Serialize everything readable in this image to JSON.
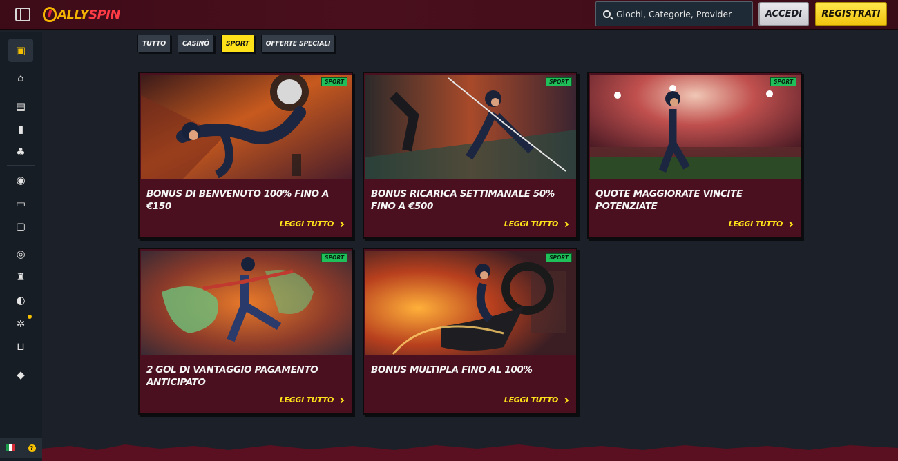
{
  "header": {
    "logo_part1": "ALLY",
    "logo_part2": "SPIN",
    "search_placeholder": "Giochi, Categorie, Provider",
    "login_label": "ACCEDI",
    "register_label": "REGISTRATI"
  },
  "sidebar": {
    "items": [
      {
        "icon": "gift-icon",
        "glyph": "▣"
      },
      {
        "icon": "home-icon",
        "glyph": "⌂"
      },
      {
        "icon": "slot-machine-icon",
        "glyph": "▤"
      },
      {
        "icon": "cards-icon",
        "glyph": "▮"
      },
      {
        "icon": "clover-icon",
        "glyph": "♣"
      },
      {
        "icon": "football-icon",
        "glyph": "◉"
      },
      {
        "icon": "live-icon",
        "glyph": "▭"
      },
      {
        "icon": "live-casino-icon",
        "glyph": "▢"
      },
      {
        "icon": "medal-icon",
        "glyph": "◎"
      },
      {
        "icon": "trophy-icon",
        "glyph": "♜"
      },
      {
        "icon": "helmet-icon",
        "glyph": "◐"
      },
      {
        "icon": "film-reel-icon",
        "glyph": "✲"
      },
      {
        "icon": "cart-icon",
        "glyph": "⊔"
      },
      {
        "icon": "diamond-icon",
        "glyph": "◆"
      }
    ],
    "help_glyph": "?"
  },
  "tabs": [
    {
      "label": "TUTTO",
      "active": false
    },
    {
      "label": "CASINÒ",
      "active": false
    },
    {
      "label": "SPORT",
      "active": true
    },
    {
      "label": "OFFERTE SPECIALI",
      "active": false
    }
  ],
  "cards": [
    {
      "badge": "SPORT",
      "title": "BONUS DI BENVENUTO 100% FINO A €150",
      "link": "LEGGI TUTTO"
    },
    {
      "badge": "SPORT",
      "title": "BONUS RICARICA SETTIMANALE 50% FINO A €500",
      "link": "LEGGI TUTTO"
    },
    {
      "badge": "SPORT",
      "title": "QUOTE MAGGIORATE VINCITE POTENZIATE",
      "link": "LEGGI TUTTO"
    },
    {
      "badge": "SPORT",
      "title": "2 GOL DI VANTAGGIO PAGAMENTO ANTICIPATO",
      "link": "LEGGI TUTTO"
    },
    {
      "badge": "SPORT",
      "title": "BONUS MULTIPLA FINO AL 100%",
      "link": "LEGGI TUTTO"
    }
  ],
  "colors": {
    "accent_yellow": "#ffe11a",
    "card_bg": "#4a1020",
    "page_bg": "#1c2129",
    "badge_green": "#1fbf5a"
  }
}
